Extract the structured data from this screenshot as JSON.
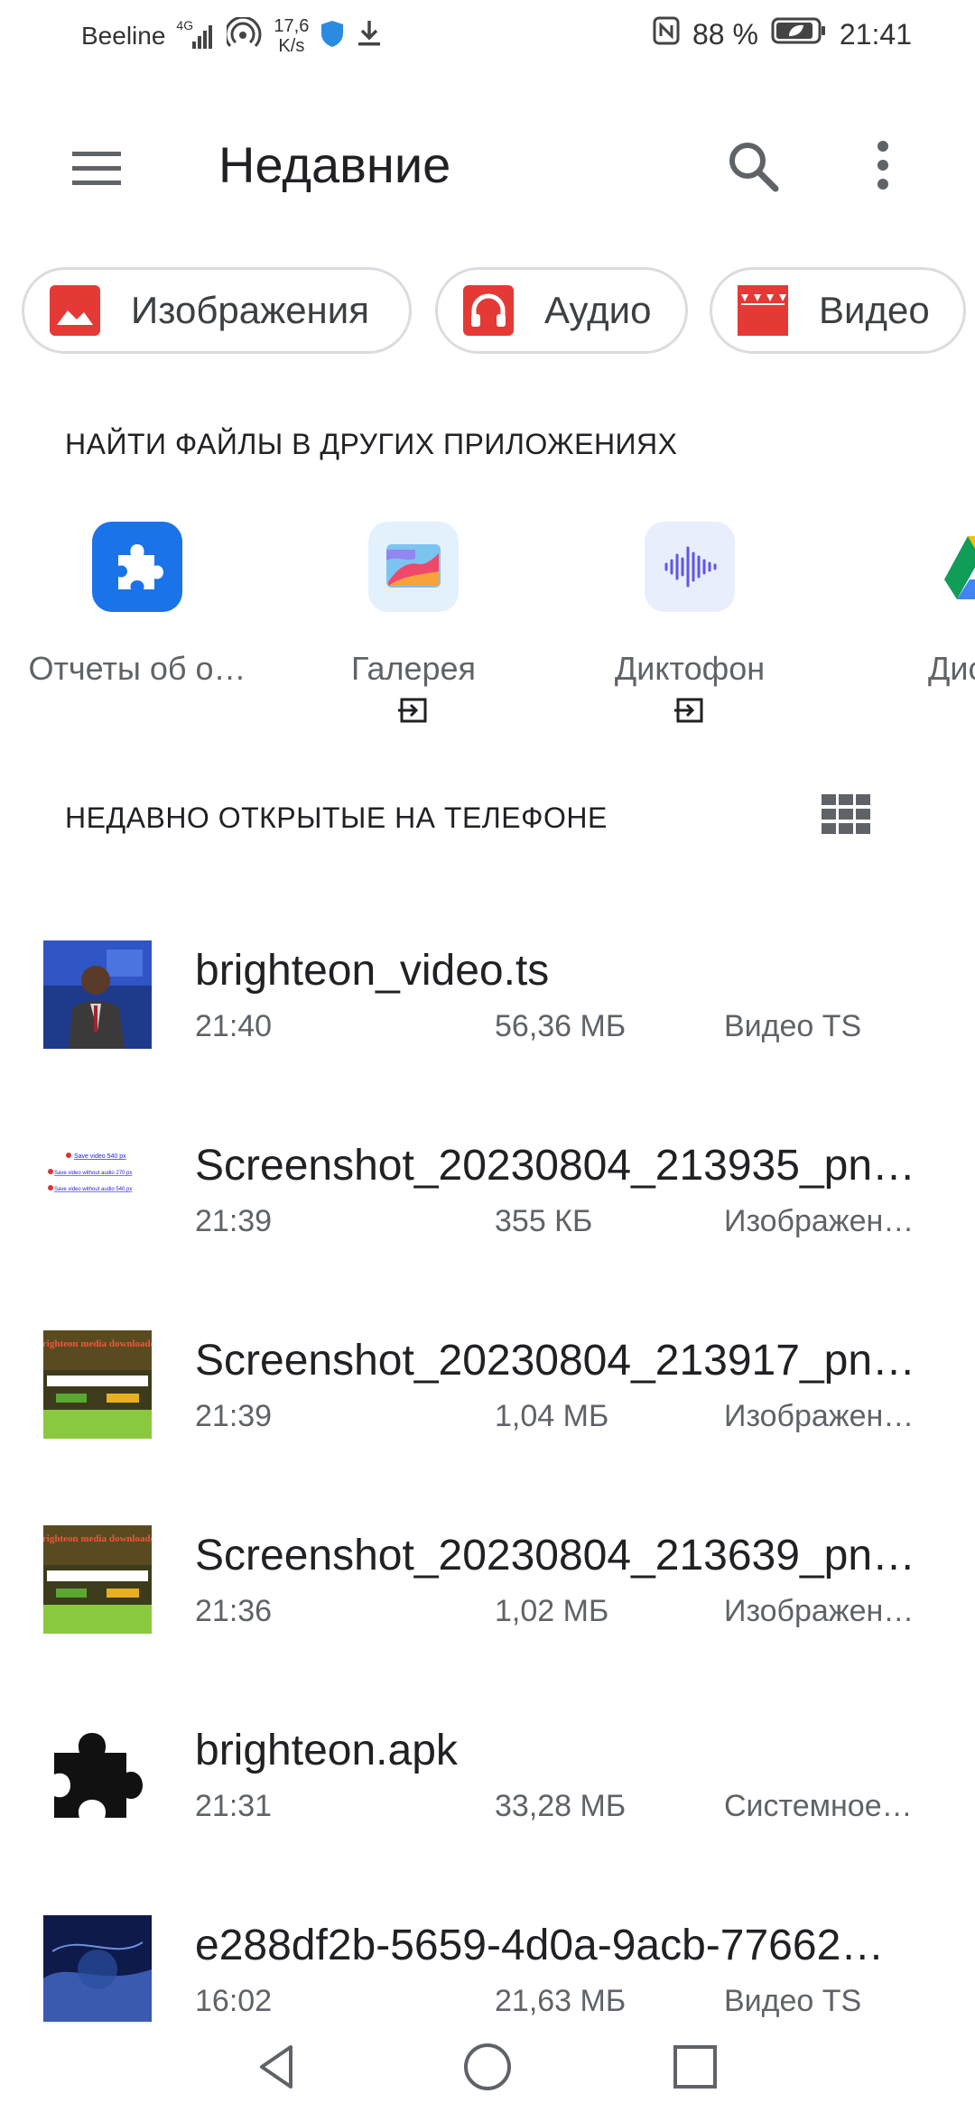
{
  "status_bar": {
    "carrier": "Beeline",
    "network": "4G",
    "speed_value": "17,6",
    "speed_unit": "K/s",
    "battery": "88 %",
    "time": "21:41"
  },
  "appbar": {
    "title": "Недавние",
    "menu_icon": "hamburger-menu-icon",
    "search_icon": "search-icon",
    "more_icon": "more-vert-icon"
  },
  "chips": [
    {
      "label": "Изображения",
      "icon": "image-icon",
      "color": "#e53935"
    },
    {
      "label": "Аудио",
      "icon": "headphones-icon",
      "color": "#e53935"
    },
    {
      "label": "Видео",
      "icon": "clapper-icon",
      "color": "#e53935"
    }
  ],
  "apps_section": {
    "title": "НАЙТИ ФАЙЛЫ В ДРУГИХ ПРИЛОЖЕНИЯХ",
    "apps": [
      {
        "label": "Отчеты об о…",
        "icon": "puzzle-icon",
        "color": "#1a73e8"
      },
      {
        "label": "Галерея",
        "icon": "gallery-icon"
      },
      {
        "label": "Диктофон",
        "icon": "voice-recorder-icon"
      },
      {
        "label": "Дис",
        "icon": "drive-icon"
      }
    ]
  },
  "recent_section": {
    "title": "НЕДАВНО ОТКРЫТЫЕ НА ТЕЛЕФОНЕ",
    "view_icon": "grid-view-icon"
  },
  "files": [
    {
      "name": "brighteon_video.ts",
      "time": "21:40",
      "size": "56,36 МБ",
      "type": "Видео TS"
    },
    {
      "name": "Screenshot_20230804_213935_pnz…",
      "time": "21:39",
      "size": "355 КБ",
      "type": "Изображен…"
    },
    {
      "name": "Screenshot_20230804_213917_pnz…",
      "time": "21:39",
      "size": "1,04 МБ",
      "type": "Изображен…"
    },
    {
      "name": "Screenshot_20230804_213639_pnz…",
      "time": "21:36",
      "size": "1,02 МБ",
      "type": "Изображен…"
    },
    {
      "name": "brighteon.apk",
      "time": "21:31",
      "size": "33,28 МБ",
      "type": "Системное…"
    },
    {
      "name": "e288df2b-5659-4d0a-9acb-77662…",
      "time": "16:02",
      "size": "21,63 МБ",
      "type": "Видео TS"
    }
  ],
  "thumb_text": {
    "save_540": "Save video 540 px",
    "save_270": "Save video without audio 270 px",
    "save_540b": "Save video without audio 540 px",
    "brighteon_title": "Brighteon media downloader"
  }
}
